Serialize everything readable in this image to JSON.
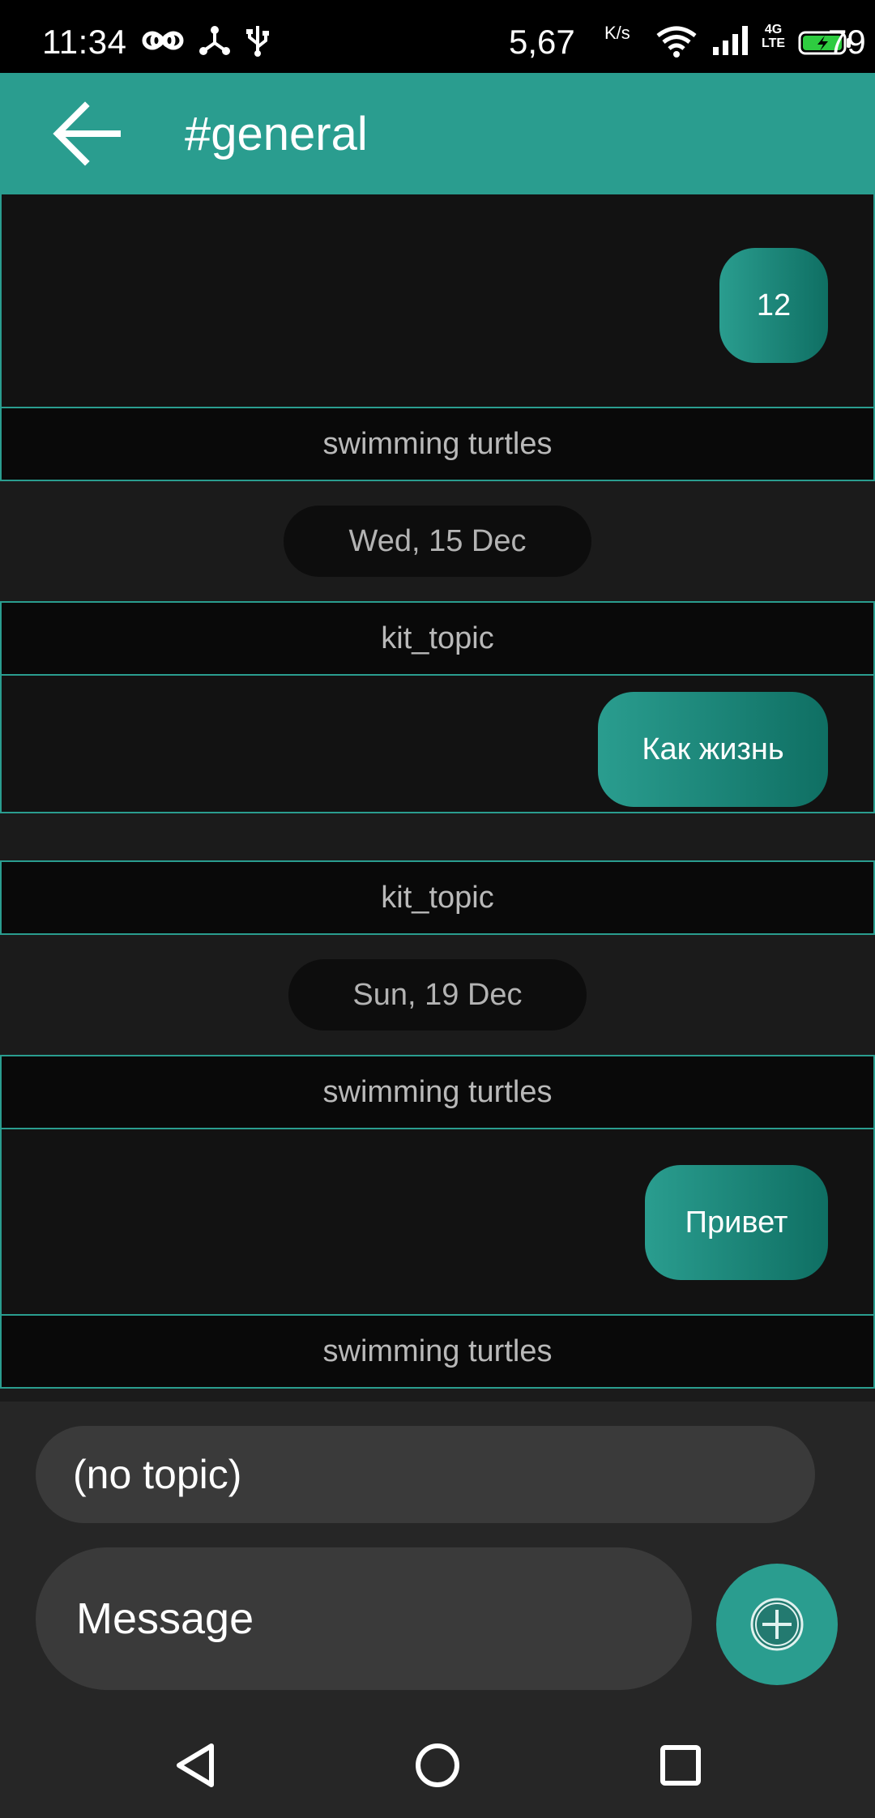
{
  "status_bar": {
    "time": "11:34",
    "speed": "5,67",
    "speed_unit": "K/s",
    "network": "4G\nLTE",
    "battery": "79",
    "icons": [
      "infinity-icon",
      "hub-icon",
      "usb-icon",
      "wifi-icon",
      "signal-icon",
      "battery-charging-icon"
    ]
  },
  "app_bar": {
    "title": "#general",
    "back_icon": "arrow-left-icon"
  },
  "messages": [
    {
      "type": "message",
      "text": "12"
    },
    {
      "type": "topic",
      "text": "swimming turtles"
    },
    {
      "type": "date",
      "text": "Wed, 15 Dec"
    },
    {
      "type": "topic",
      "text": "kit_topic"
    },
    {
      "type": "message",
      "text": "Как жизнь"
    },
    {
      "type": "topic",
      "text": "kit_topic"
    },
    {
      "type": "date",
      "text": "Sun, 19 Dec"
    },
    {
      "type": "topic",
      "text": "swimming turtles"
    },
    {
      "type": "message",
      "text": "Привет"
    },
    {
      "type": "topic",
      "text": "swimming turtles"
    }
  ],
  "compose": {
    "topic_placeholder": "(no topic)",
    "message_placeholder": "Message",
    "add_icon": "plus-circle-icon"
  },
  "nav": {
    "icons": [
      "back-triangle-icon",
      "home-circle-icon",
      "recents-square-icon"
    ]
  },
  "colors": {
    "accent": "#2a9d8f",
    "background": "#1b1b1b",
    "message_area": "#121212"
  }
}
